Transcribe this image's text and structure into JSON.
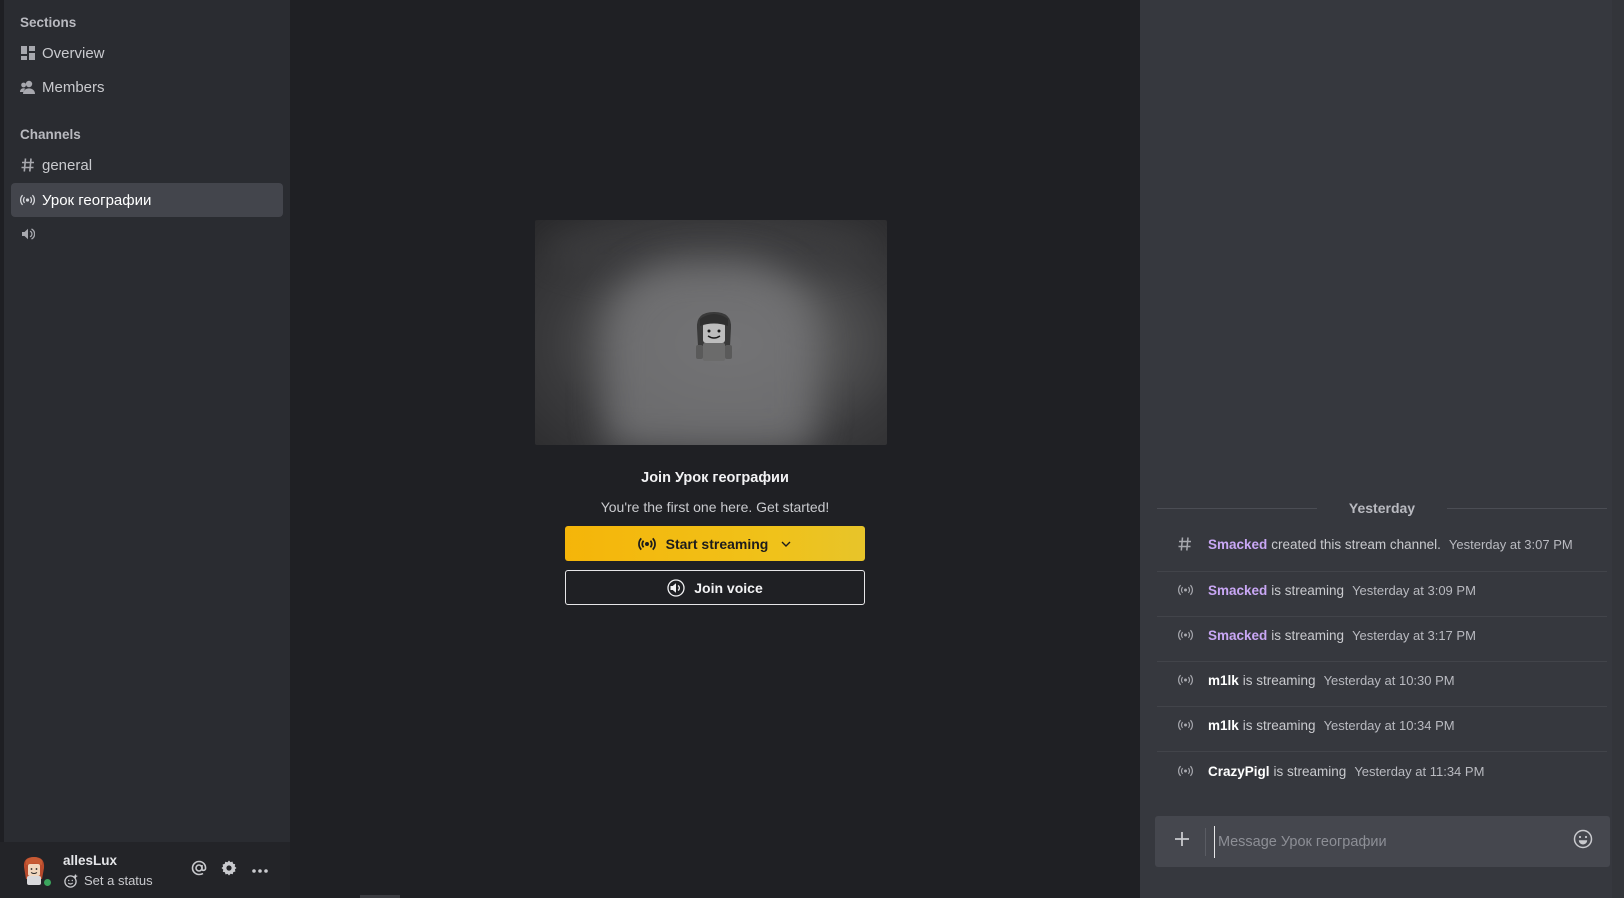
{
  "sidebar": {
    "sections_title": "Sections",
    "sections": [
      {
        "label": "Overview",
        "icon": "grid-icon"
      },
      {
        "label": "Members",
        "icon": "members-icon"
      }
    ],
    "channels_title": "Channels",
    "channels": [
      {
        "label": "general",
        "icon": "hash-icon"
      },
      {
        "label": "Урок географии",
        "icon": "stream-icon",
        "active": true
      },
      {
        "label": "",
        "icon": "speaker-icon"
      }
    ]
  },
  "user": {
    "name": "allesLux",
    "status_label": "Set a status",
    "presence_color": "#3ba55d"
  },
  "main": {
    "title": "Join Урок географии",
    "subtitle": "You're the first one here. Get started!",
    "stream_button": "Start streaming",
    "voice_button": "Join voice",
    "accent": "#f5b509"
  },
  "chat": {
    "divider": "Yesterday",
    "messages": [
      {
        "icon": "hash-icon",
        "who": "Smacked",
        "who_color": "purple",
        "action": "created this stream channel.",
        "time": "Yesterday at 3:07 PM"
      },
      {
        "icon": "stream-icon",
        "who": "Smacked",
        "who_color": "purple",
        "action": "is streaming",
        "time": "Yesterday at 3:09 PM"
      },
      {
        "icon": "stream-icon",
        "who": "Smacked",
        "who_color": "purple",
        "action": "is streaming",
        "time": "Yesterday at 3:17 PM"
      },
      {
        "icon": "stream-icon",
        "who": "m1lk",
        "who_color": "white",
        "action": "is streaming",
        "time": "Yesterday at 10:30 PM"
      },
      {
        "icon": "stream-icon",
        "who": "m1lk",
        "who_color": "white",
        "action": "is streaming",
        "time": "Yesterday at 10:34 PM"
      },
      {
        "icon": "stream-icon",
        "who": "CrazyPigl",
        "who_color": "white",
        "action": "is streaming",
        "time": "Yesterday at 11:34 PM"
      }
    ],
    "composer_placeholder": "Message Урок географии"
  }
}
